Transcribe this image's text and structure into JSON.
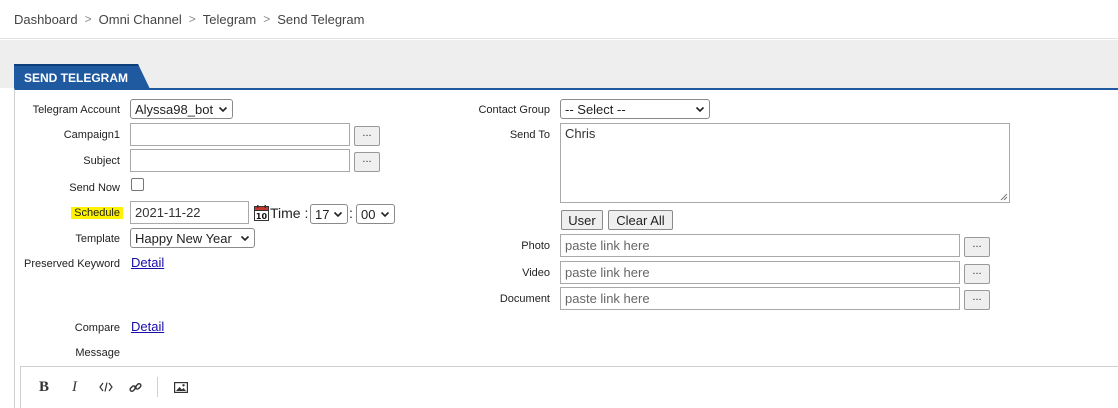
{
  "breadcrumb": {
    "items": [
      "Dashboard",
      "Omni Channel",
      "Telegram",
      "Send Telegram"
    ],
    "separator": ">"
  },
  "tab": {
    "label": "SEND TELEGRAM"
  },
  "form": {
    "telegram_account": {
      "label": "Telegram Account",
      "value": "Alyssa98_bot"
    },
    "campaign": {
      "label": "Campaign1",
      "value": "",
      "browse_label": "..."
    },
    "subject": {
      "label": "Subject",
      "value": "",
      "browse_label": "..."
    },
    "send_now": {
      "label": "Send Now",
      "checked": false
    },
    "schedule": {
      "label": "Schedule",
      "date": "2021-11-22",
      "time_label": "Time :",
      "hour": "17",
      "colon": ":",
      "minute": "00"
    },
    "template": {
      "label": "Template",
      "value": "Happy New Year"
    },
    "preserved_keyword": {
      "label": "Preserved Keyword",
      "link": "Detail"
    },
    "compare": {
      "label": "Compare",
      "link": "Detail"
    },
    "message": {
      "label": "Message"
    },
    "contact_group": {
      "label": "Contact Group",
      "value": "-- Select --"
    },
    "send_to": {
      "label": "Send To",
      "value": "Chris",
      "user_button": "User",
      "clear_all_button": "Clear All"
    },
    "photo": {
      "label": "Photo",
      "placeholder": "paste link here",
      "browse_label": "..."
    },
    "video": {
      "label": "Video",
      "placeholder": "paste link here",
      "browse_label": "..."
    },
    "document": {
      "label": "Document",
      "placeholder": "paste link here",
      "browse_label": "..."
    }
  },
  "editor_toolbar": {
    "bold": "B",
    "italic": "I",
    "icons": [
      "code-icon",
      "link-icon",
      "image-icon"
    ]
  },
  "colors": {
    "tab_blue": "#1f5aa0",
    "highlight_yellow": "#fff200",
    "link_blue": "#1a0dab"
  }
}
